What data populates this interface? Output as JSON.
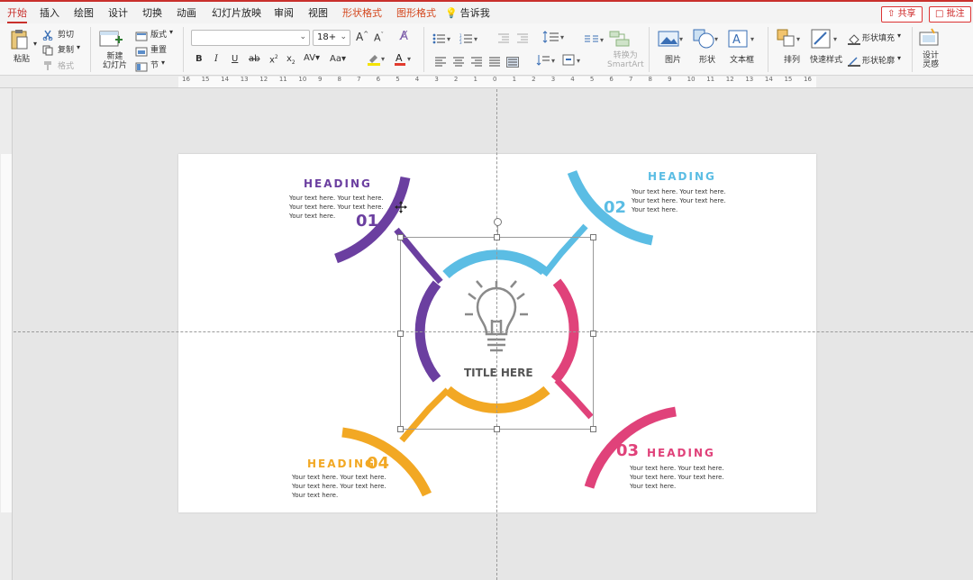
{
  "tabs": [
    {
      "label": "开始",
      "active": true
    },
    {
      "label": "插入"
    },
    {
      "label": "绘图"
    },
    {
      "label": "设计"
    },
    {
      "label": "切换"
    },
    {
      "label": "动画"
    },
    {
      "label": "幻灯片放映"
    },
    {
      "label": "审阅"
    },
    {
      "label": "视图"
    },
    {
      "label": "形状格式",
      "highlight": true
    },
    {
      "label": "图形格式",
      "highlight": true
    },
    {
      "label": "告诉我"
    }
  ],
  "top_buttons": {
    "share": "共享",
    "comment": "批注"
  },
  "ribbon": {
    "paste": "粘贴",
    "cut": "剪切",
    "copy": "复制",
    "format": "格式",
    "new_slide": "新建\n幻灯片",
    "layout": "版式",
    "reset": "重置",
    "section": "节",
    "font_name": "",
    "font_size": "18+",
    "convert_smartart": "转换为\nSmartArt",
    "picture": "图片",
    "shape": "形状",
    "textbox": "文本框",
    "arrange": "排列",
    "quick_styles": "快速样式",
    "shape_fill": "形状填充",
    "shape_outline": "形状轮廓",
    "design_ideas": "设计\n灵感"
  },
  "ruler": {
    "h_marks": [
      "16",
      "15",
      "14",
      "13",
      "12",
      "11",
      "10",
      "9",
      "8",
      "7",
      "6",
      "5",
      "4",
      "3",
      "2",
      "1",
      "0",
      "1",
      "2",
      "3",
      "4",
      "5",
      "6",
      "7",
      "8",
      "9",
      "10",
      "11",
      "12",
      "13",
      "14",
      "15",
      "16"
    ]
  },
  "slide": {
    "title": "TITLE HERE",
    "items": [
      {
        "heading": "HEADING",
        "number": "01",
        "color": "#6b3fa0",
        "text": [
          "Your text here. Your text here.",
          "Your text here. Your text here.",
          "Your text here."
        ]
      },
      {
        "heading": "HEADING",
        "number": "02",
        "color": "#5bbde4",
        "text": [
          "Your text here. Your text here.",
          "Your text here. Your text here.",
          "Your text here."
        ]
      },
      {
        "heading": "HEADING",
        "number": "03",
        "color": "#e0427a",
        "text": [
          "Your text here. Your text here.",
          "Your text here. Your text here.",
          "Your text here."
        ]
      },
      {
        "heading": "HEADING",
        "number": "04",
        "color": "#f2a824",
        "text": [
          "Your text here. Your text here.",
          "Your text here. Your text here.",
          "Your text here."
        ]
      }
    ],
    "icon": "lightbulb-icon"
  }
}
